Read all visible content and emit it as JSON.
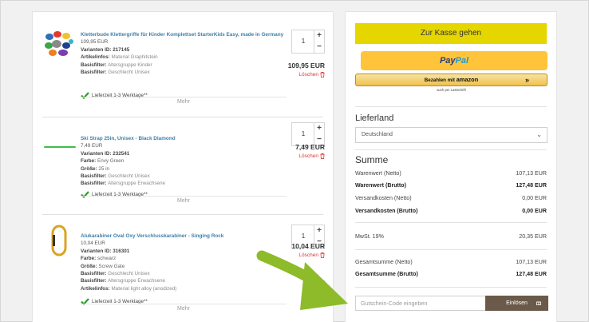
{
  "cart": {
    "more_label": "Mehr",
    "items": [
      {
        "title": "Kletterbude Klettergriffe für Kinder Komplettset StarterKids Easy, made in Germany",
        "price": "109,95 EUR",
        "variant_label": "Varianten ID:",
        "variant_id": "217145",
        "attrs": [
          {
            "label": "Artikelinfos:",
            "value": "Material Graphitstein"
          },
          {
            "label": "Basisfilter:",
            "value": "Altersgruppe Kinder"
          },
          {
            "label": "Basisfilter:",
            "value": "Geschlecht Unisex"
          }
        ],
        "shipping": "Lieferzeit 1-3 Werktage**",
        "quantity": "1",
        "line_total": "109,95 EUR",
        "delete_label": "Löschen"
      },
      {
        "title": "Ski Strap 25in, Unisex - Black Diamond",
        "price": "7,49 EUR",
        "variant_label": "Varianten ID:",
        "variant_id": "232541",
        "attrs": [
          {
            "label": "Farbe:",
            "value": "Envy Green"
          },
          {
            "label": "Größe:",
            "value": "25 in"
          },
          {
            "label": "Basisfilter:",
            "value": "Geschlecht Unisex"
          },
          {
            "label": "Basisfilter:",
            "value": "Altersgruppe Erwachsene"
          }
        ],
        "shipping": "Lieferzeit 1-3 Werktage**",
        "quantity": "1",
        "line_total": "7,49 EUR",
        "delete_label": "Löschen"
      },
      {
        "title": "Alukarabiner Oval Oxy Verschlusskarabiner - Singing Rock",
        "price": "10,04 EUR",
        "variant_label": "Varianten ID:",
        "variant_id": "316301",
        "attrs": [
          {
            "label": "Farbe:",
            "value": "schwarz"
          },
          {
            "label": "Größe:",
            "value": "Screw Gate"
          },
          {
            "label": "Basisfilter:",
            "value": "Geschlecht Unisex"
          },
          {
            "label": "Basisfilter:",
            "value": "Altersgruppe Erwachsene"
          },
          {
            "label": "Artikelinfos:",
            "value": "Material light alloy (anodized)"
          }
        ],
        "shipping": "Lieferzeit 1-3 Werktage**",
        "quantity": "1",
        "line_total": "10,04 EUR",
        "delete_label": "Löschen"
      }
    ]
  },
  "checkout": {
    "kasse_label": "Zur Kasse gehen",
    "paypal_part1": "Pay",
    "paypal_part2": "Pal",
    "amazon_prefix": "Bezahlen mit",
    "amazon_word": "amazon",
    "amazon_arrow": "»",
    "amazon_sub": "auch per Lastschrift"
  },
  "delivery": {
    "heading": "Lieferland",
    "selected_country": "Deutschland"
  },
  "summary": {
    "heading": "Summe",
    "rows": [
      {
        "label": "Warenwert (Netto)",
        "value": "107,13 EUR"
      },
      {
        "label": "Warenwert (Brutto)",
        "value": "127,48 EUR"
      },
      {
        "label": "Versandkosten (Netto)",
        "value": "0,00 EUR"
      },
      {
        "label": "Versandkosten (Brutto)",
        "value": "0,00 EUR"
      },
      {
        "label": "MwSt. 19%",
        "value": "20,35 EUR"
      },
      {
        "label": "Gesamtsumme (Netto)",
        "value": "107,13 EUR"
      },
      {
        "label": "Gesamtsumme (Brutto)",
        "value": "127,48 EUR"
      }
    ]
  },
  "coupon": {
    "placeholder": "Gutschein-Code eingeben",
    "button_label": "Einlösen"
  },
  "colors": {
    "kasse_button": "#e6d600",
    "paypal_button": "#ffc439",
    "coupon_button": "#6b5a4a",
    "delete_link": "#dd3333",
    "title_link": "#3f7fa8",
    "check_green": "#2e9e2e",
    "arrow_green": "#8dbb2a"
  }
}
